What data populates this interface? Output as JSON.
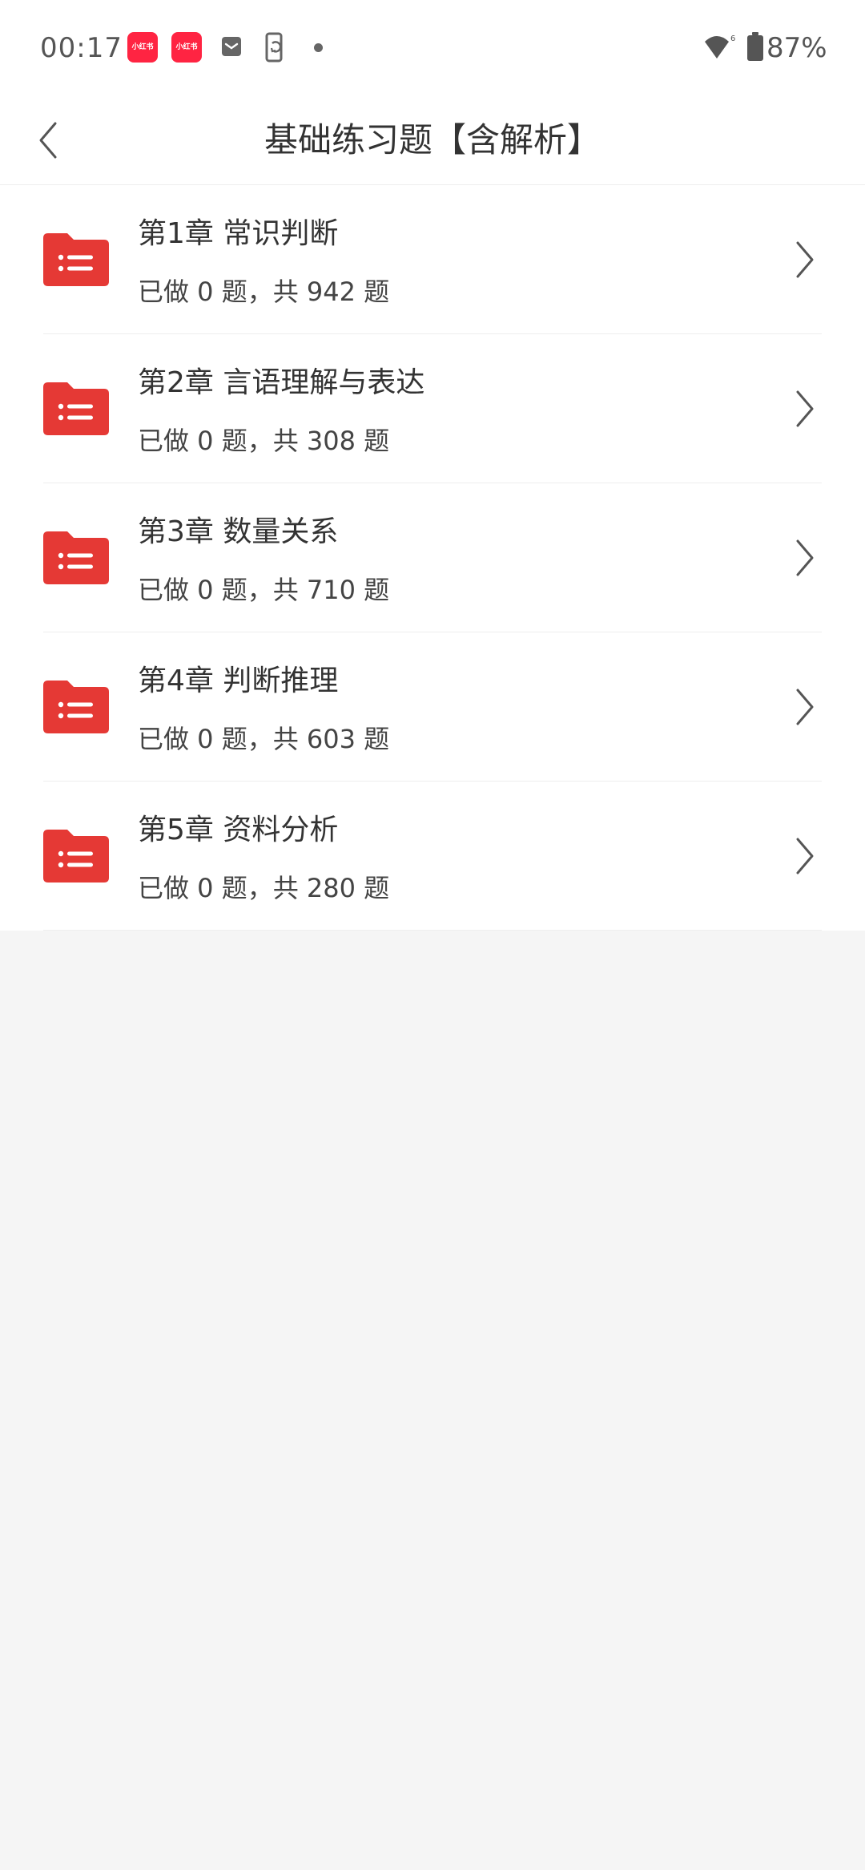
{
  "status_bar": {
    "time": "00:17",
    "notifications": [
      {
        "label": "小红书",
        "icon": "xiaohongshu-icon",
        "color": "#ff2442"
      },
      {
        "label": "小红书",
        "icon": "xiaohongshu-icon",
        "color": "#ff2442"
      }
    ],
    "icons": [
      "mail-icon",
      "phone-sync-icon",
      "dot-icon",
      "wifi-icon",
      "battery-icon"
    ],
    "battery": "87%"
  },
  "header": {
    "title": "基础练习题【含解析】",
    "back_icon": "chevron-left-icon"
  },
  "colors": {
    "accent": "#e53935",
    "text_primary": "#333333",
    "background": "#f5f5f5"
  },
  "chapters": [
    {
      "title": "第1章 常识判断",
      "count": "已做 0 题，共 942 题"
    },
    {
      "title": "第2章 言语理解与表达",
      "count": "已做 0 题，共 308 题"
    },
    {
      "title": "第3章 数量关系",
      "count": "已做 0 题，共 710 题"
    },
    {
      "title": "第4章 判断推理",
      "count": "已做 0 题，共 603 题"
    },
    {
      "title": "第5章 资料分析",
      "count": "已做 0 题，共 280 题"
    }
  ]
}
